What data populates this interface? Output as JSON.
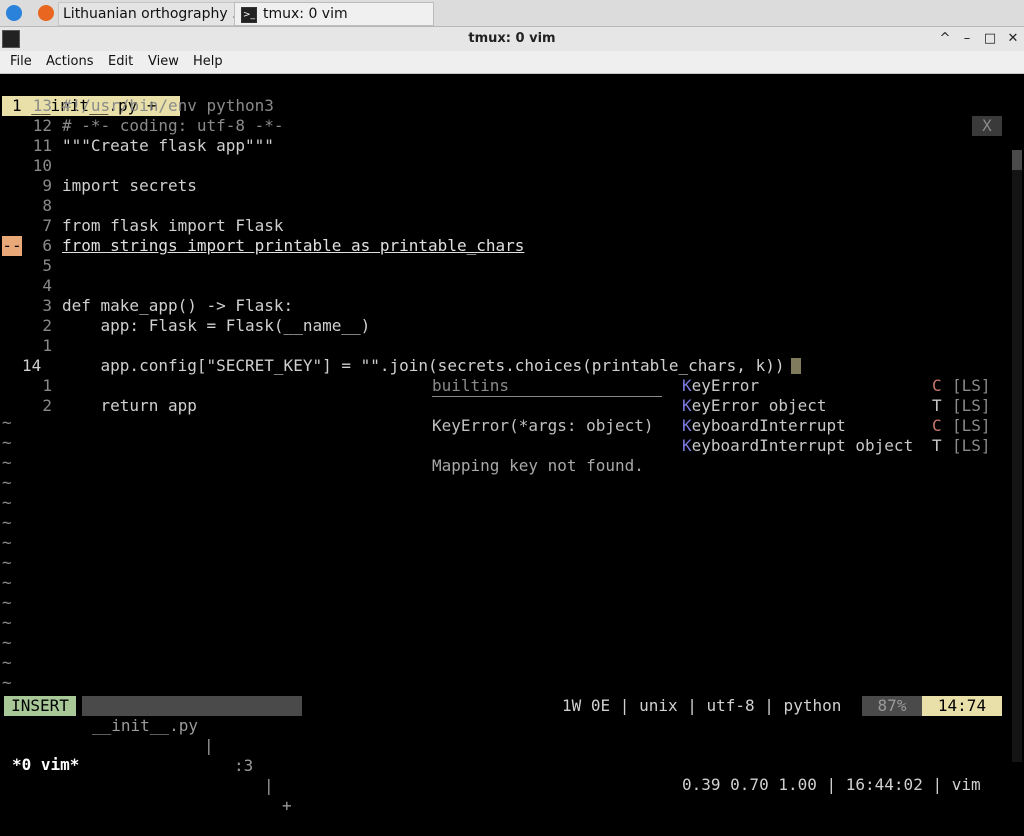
{
  "taskbar": {
    "tabs": [
      {
        "label": "Lithuanian orthography ...",
        "icon": "firefox-icon"
      },
      {
        "label": "tmux: 0 vim",
        "icon": "terminal-icon"
      }
    ]
  },
  "window": {
    "title": "tmux: 0 vim",
    "controls": {
      "minimize": "^",
      "restore": "–",
      "maximize": "□",
      "close": "✕"
    }
  },
  "menu": [
    "File",
    "Actions",
    "Edit",
    "View",
    "Help"
  ],
  "vim": {
    "tabline": {
      "tab": "1 __init__.py +",
      "close": "X"
    },
    "lines": [
      {
        "num": "13",
        "text": "#!/usr/bin/env python3"
      },
      {
        "num": "12",
        "text": "# -*- coding: utf-8 -*-"
      },
      {
        "num": "11",
        "text": "\"\"\"Create flask app\"\"\""
      },
      {
        "num": "10",
        "text": ""
      },
      {
        "num": "9",
        "text": "import secrets"
      },
      {
        "num": "8",
        "text": ""
      },
      {
        "num": "7",
        "text": "from flask import Flask"
      },
      {
        "num": "6",
        "text": "from strings import printable as printable_chars",
        "sign": "--"
      },
      {
        "num": "5",
        "text": ""
      },
      {
        "num": "4",
        "text": ""
      },
      {
        "num": "3",
        "text": "def make_app() -> Flask:"
      },
      {
        "num": "2",
        "text": "    app: Flask = Flask(__name__)"
      },
      {
        "num": "1",
        "text": ""
      },
      {
        "num": "14",
        "text": "    app.config[\"SECRET_KEY\"] = \"\".join(secrets.choices(printable_chars, k))",
        "current": true
      },
      {
        "num": "1",
        "text": ""
      },
      {
        "num": "2",
        "text": "    return app"
      }
    ],
    "tilde": "~",
    "popup": {
      "info": [
        "builtins",
        "────────────────────────",
        "KeyError(*args: object)",
        "",
        "Mapping key not found."
      ],
      "items": [
        {
          "match": "K",
          "rest": "eyError",
          "kind": "C",
          "src": "[LS]"
        },
        {
          "match": "K",
          "rest": "eyError object",
          "kind": "T",
          "src": "[LS]"
        },
        {
          "match": "K",
          "rest": "eyboardInterrupt",
          "kind": "C",
          "src": "[LS]"
        },
        {
          "match": "K",
          "rest": "eyboardInterrupt object",
          "kind": "T",
          "src": "[LS]"
        }
      ]
    },
    "statusline": {
      "mode": "INSERT",
      "file": "__init__.py",
      "info1": ":3",
      "info2": "+",
      "right": "1W 0E | unix | utf-8 | python",
      "percent": "87%",
      "pos": "14:74"
    }
  },
  "tmux": {
    "left": "*0 vim*",
    "right": "0.39 0.70 1.00 | 16:44:02 | vim"
  }
}
